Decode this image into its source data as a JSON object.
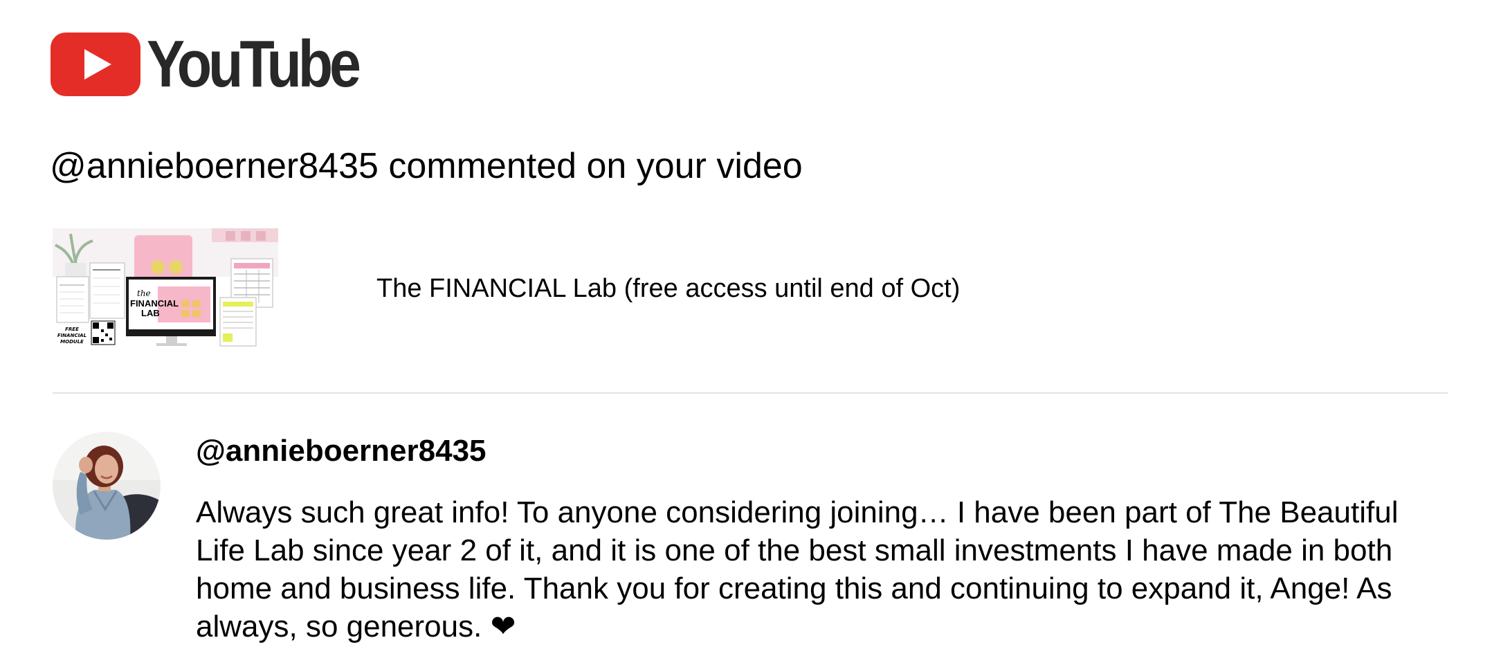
{
  "brand": {
    "wordmark": "YouTube",
    "icon": "youtube-play-icon",
    "color": "#e52d27"
  },
  "notification": {
    "headline": "@annieboerner8435 commented on your video"
  },
  "video": {
    "title": "The FINANCIAL Lab (free access until end of Oct)",
    "thumbnail": {
      "main_text": "FINANCIAL LAB",
      "script_text": "the",
      "side_text": "FREE FINANCIAL MODULE"
    }
  },
  "comment": {
    "author": "@annieboerner8435",
    "text": "Always such great info! To anyone considering joining… I have been part of The Beautiful Life Lab since year 2 of it, and it is one of the best small investments I have made in both home and business life. Thank you for creating this and continuing to expand it, Ange! As always, so generous. ❤"
  },
  "colors": {
    "divider": "#e2e2e2",
    "text": "#000000",
    "wordmark": "#282828"
  }
}
